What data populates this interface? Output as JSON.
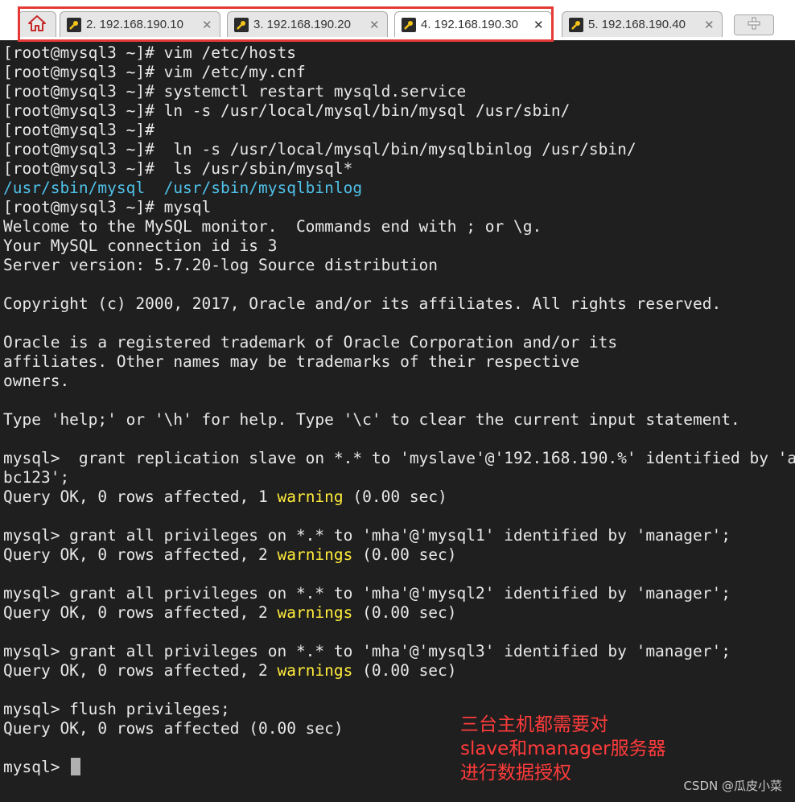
{
  "tabs": [
    {
      "label": "2. 192.168.190.10",
      "active": false
    },
    {
      "label": "3. 192.168.190.20",
      "active": false
    },
    {
      "label": "4. 192.168.190.30",
      "active": true
    },
    {
      "label": "5. 192.168.190.40",
      "active": false
    }
  ],
  "terminal": {
    "l01": "[root@mysql3 ~]# vim /etc/hosts",
    "l02": "[root@mysql3 ~]# vim /etc/my.cnf",
    "l03": "[root@mysql3 ~]# systemctl restart mysqld.service",
    "l04": "[root@mysql3 ~]# ln -s /usr/local/mysql/bin/mysql /usr/sbin/",
    "l05": "[root@mysql3 ~]#",
    "l06": "[root@mysql3 ~]#  ln -s /usr/local/mysql/bin/mysqlbinlog /usr/sbin/",
    "l07": "[root@mysql3 ~]#  ls /usr/sbin/mysql*",
    "l08": "/usr/sbin/mysql  /usr/sbin/mysqlbinlog",
    "l09": "[root@mysql3 ~]# mysql",
    "l10": "Welcome to the MySQL monitor.  Commands end with ; or \\g.",
    "l11": "Your MySQL connection id is 3",
    "l12": "Server version: 5.7.20-log Source distribution",
    "l13": "Copyright (c) 2000, 2017, Oracle and/or its affiliates. All rights reserved.",
    "l14": "Oracle is a registered trademark of Oracle Corporation and/or its",
    "l15": "affiliates. Other names may be trademarks of their respective",
    "l16": "owners.",
    "l17": "Type 'help;' or '\\h' for help. Type '\\c' to clear the current input statement.",
    "l18": "mysql>  grant replication slave on *.* to 'myslave'@'192.168.190.%' identified by 'a",
    "l19": "bc123';",
    "l20a": "Query OK, 0 rows affected, 1 ",
    "l20w": "warning",
    "l20b": " (0.00 sec)",
    "l21": "mysql> grant all privileges on *.* to 'mha'@'mysql1' identified by 'manager';",
    "l22a": "Query OK, 0 rows affected, 2 ",
    "l22w": "warnings",
    "l22b": " (0.00 sec)",
    "l23": "mysql> grant all privileges on *.* to 'mha'@'mysql2' identified by 'manager';",
    "l24a": "Query OK, 0 rows affected, 2 ",
    "l24w": "warnings",
    "l24b": " (0.00 sec)",
    "l25": "mysql> grant all privileges on *.* to 'mha'@'mysql3' identified by 'manager';",
    "l26a": "Query OK, 0 rows affected, 2 ",
    "l26w": "warnings",
    "l26b": " (0.00 sec)",
    "l27": "mysql> flush privileges;",
    "l28": "Query OK, 0 rows affected (0.00 sec)",
    "l29": "mysql> "
  },
  "annotation": {
    "line1": "三台主机都需要对",
    "line2": "slave和manager服务器",
    "line3": "进行数据授权"
  },
  "watermark": "CSDN @瓜皮小菜",
  "colors": {
    "terminal_bg": "#1f1f1f",
    "terminal_text": "#e8e8e8",
    "path_cyan": "#4fc1e9",
    "warning_yellow": "#ffeb3b",
    "annotation_red": "#ff3b3b",
    "highlight_red": "#e53935"
  }
}
